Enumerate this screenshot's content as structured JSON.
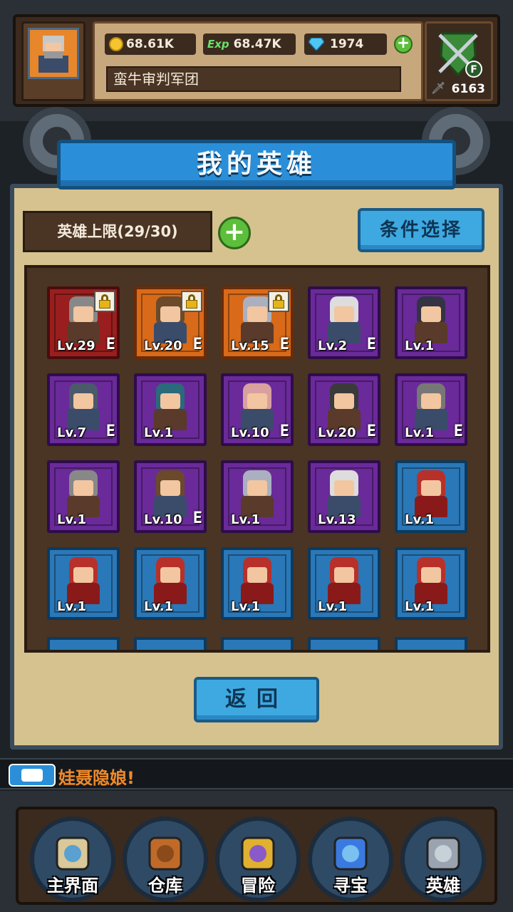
{
  "header": {
    "gold": "68.61K",
    "exp_label": "Exp",
    "exp": "68.47K",
    "gems": "1974",
    "legion_name": "蛮牛审判军团",
    "power_rank": "F",
    "power": "6163"
  },
  "page_title": "我的英雄",
  "hero_limit": "英雄上限(29/30)",
  "filter_button": "条件选择",
  "heroes": [
    {
      "level": "Lv.29",
      "rarity": "red",
      "locked": true,
      "equip": "E"
    },
    {
      "level": "Lv.20",
      "rarity": "orange",
      "locked": true,
      "equip": "E"
    },
    {
      "level": "Lv.15",
      "rarity": "orange",
      "locked": true,
      "equip": "E"
    },
    {
      "level": "Lv.2",
      "rarity": "purple",
      "locked": false,
      "equip": "E"
    },
    {
      "level": "Lv.1",
      "rarity": "purple",
      "locked": false,
      "equip": ""
    },
    {
      "level": "Lv.7",
      "rarity": "purple",
      "locked": false,
      "equip": "E"
    },
    {
      "level": "Lv.1",
      "rarity": "purple",
      "locked": false,
      "equip": ""
    },
    {
      "level": "Lv.10",
      "rarity": "purple",
      "locked": false,
      "equip": "E"
    },
    {
      "level": "Lv.20",
      "rarity": "purple",
      "locked": false,
      "equip": "E"
    },
    {
      "level": "Lv.1",
      "rarity": "purple",
      "locked": false,
      "equip": "E"
    },
    {
      "level": "Lv.1",
      "rarity": "purple",
      "locked": false,
      "equip": ""
    },
    {
      "level": "Lv.10",
      "rarity": "purple",
      "locked": false,
      "equip": "E"
    },
    {
      "level": "Lv.1",
      "rarity": "purple",
      "locked": false,
      "equip": ""
    },
    {
      "level": "Lv.13",
      "rarity": "purple",
      "locked": false,
      "equip": ""
    },
    {
      "level": "Lv.1",
      "rarity": "blue",
      "locked": false,
      "equip": ""
    },
    {
      "level": "Lv.1",
      "rarity": "blue",
      "locked": false,
      "equip": ""
    },
    {
      "level": "Lv.1",
      "rarity": "blue",
      "locked": false,
      "equip": ""
    },
    {
      "level": "Lv.1",
      "rarity": "blue",
      "locked": false,
      "equip": ""
    },
    {
      "level": "Lv.1",
      "rarity": "blue",
      "locked": false,
      "equip": ""
    },
    {
      "level": "Lv.1",
      "rarity": "blue",
      "locked": false,
      "equip": ""
    }
  ],
  "back_button": "返回",
  "chat": {
    "message": "娃聂隐娘!"
  },
  "nav": [
    {
      "label": "主界面",
      "icon": "scroll-map-icon"
    },
    {
      "label": "仓库",
      "icon": "backpack-icon"
    },
    {
      "label": "冒险",
      "icon": "sword-wings-icon"
    },
    {
      "label": "寻宝",
      "icon": "crystal-icon"
    },
    {
      "label": "英雄",
      "icon": "knight-helmet-icon"
    }
  ],
  "colors": {
    "red": "#9a1e1e",
    "orange": "#d96a1a",
    "purple": "#6a2a9a",
    "blue": "#2a78b8",
    "panel": "#d6c28f",
    "button_blue": "#3ea9e0"
  }
}
